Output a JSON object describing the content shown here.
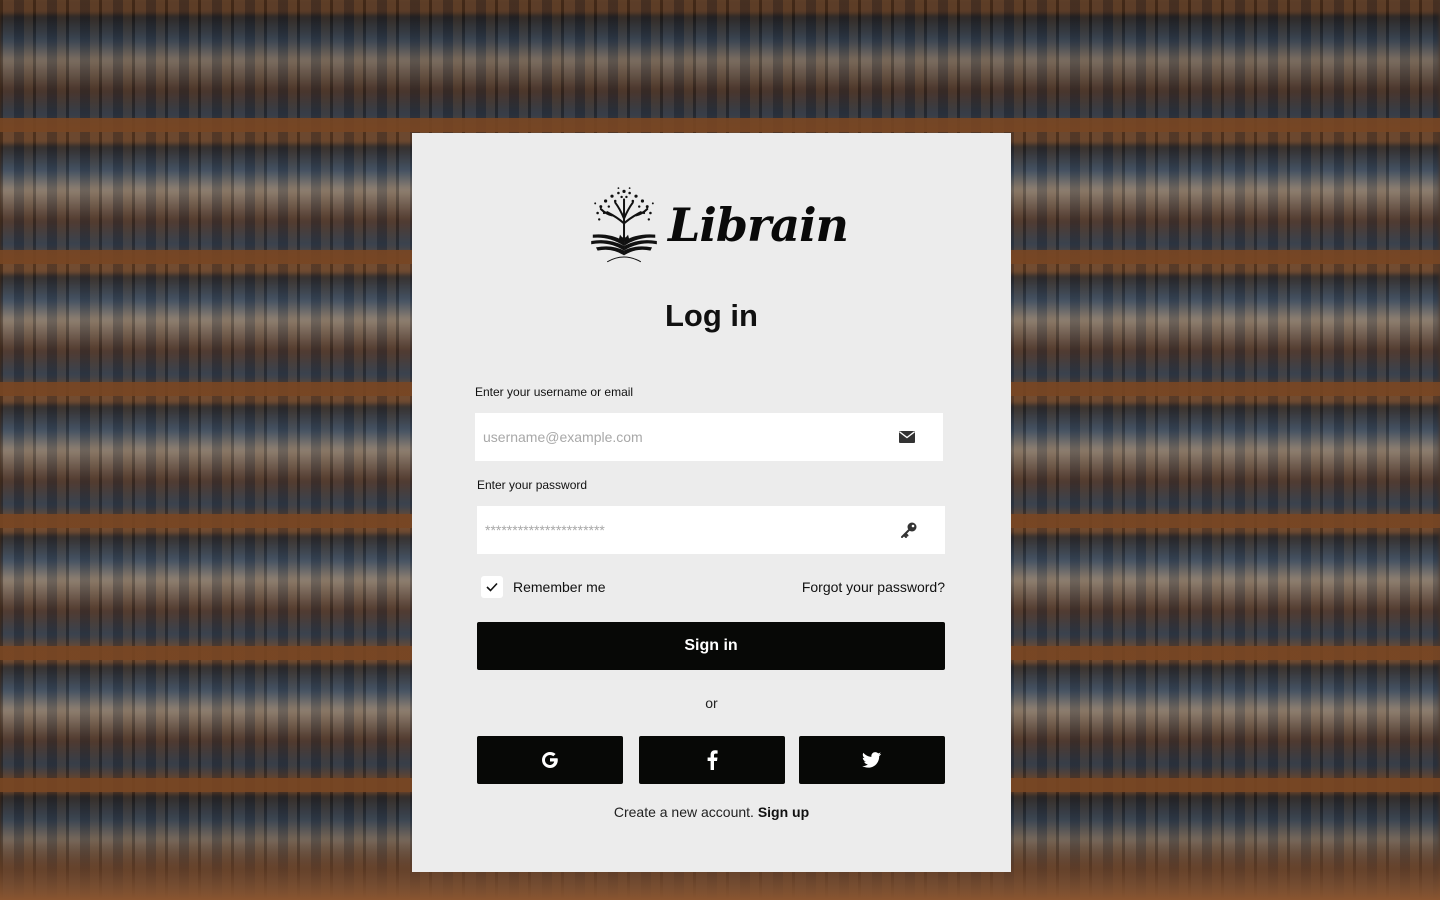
{
  "brand": {
    "name": "Librain",
    "logo_icon": "tree-book-icon"
  },
  "page": {
    "title": "Log in"
  },
  "form": {
    "username_label": "Enter your username or email",
    "username_placeholder": "username@example.com",
    "username_icon": "envelope-icon",
    "password_label": "Enter your password",
    "password_placeholder": "**********************",
    "password_icon": "key-icon",
    "remember_label": "Remember me",
    "remember_checked": true,
    "forgot_label": "Forgot your password?",
    "signin_label": "Sign in",
    "or_label": "or"
  },
  "social": [
    {
      "name": "google",
      "icon": "google-icon"
    },
    {
      "name": "facebook",
      "icon": "facebook-icon"
    },
    {
      "name": "twitter",
      "icon": "twitter-icon"
    }
  ],
  "footer": {
    "prompt": "Create a new account.",
    "signup_label": "Sign up"
  },
  "colors": {
    "card_bg": "#ececec",
    "button_bg": "#070806",
    "button_text": "#ffffff"
  }
}
